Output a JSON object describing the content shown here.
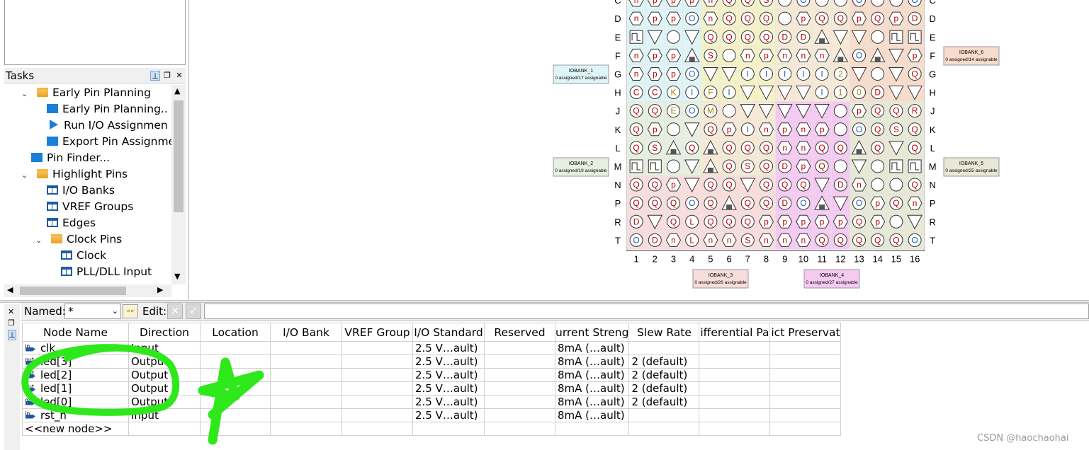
{
  "tasks": {
    "title": "Tasks",
    "tree": [
      {
        "label": "Early Pin Planning",
        "icon": "folder-icon",
        "expanded": true
      },
      {
        "label": "Early Pin Planning..",
        "icon": "task-icon"
      },
      {
        "label": "Run I/O Assignmen",
        "icon": "play-icon"
      },
      {
        "label": "Export Pin Assignme",
        "icon": "task-icon"
      },
      {
        "label": "Pin Finder...",
        "icon": "task-icon"
      },
      {
        "label": "Highlight Pins",
        "icon": "folder-icon",
        "expanded": true
      },
      {
        "label": "I/O Banks",
        "icon": "table-icon"
      },
      {
        "label": "VREF Groups",
        "icon": "table-icon"
      },
      {
        "label": "Edges",
        "icon": "table-icon"
      },
      {
        "label": "Clock Pins",
        "icon": "folder-icon",
        "expanded": true
      },
      {
        "label": "Clock",
        "icon": "table-icon"
      },
      {
        "label": "PLL/DLL Input",
        "icon": "table-icon"
      }
    ]
  },
  "package": {
    "row_labels": [
      "C",
      "D",
      "E",
      "F",
      "G",
      "H",
      "J",
      "K",
      "L",
      "M",
      "N",
      "P",
      "R",
      "T"
    ],
    "col_labels": [
      "1",
      "2",
      "3",
      "4",
      "5",
      "6",
      "7",
      "8",
      "9",
      "10",
      "11",
      "12",
      "13",
      "14",
      "15",
      "16"
    ],
    "iobanks": [
      {
        "name": "IOBANK_1",
        "status": "0 assigned/17 assignable",
        "color": "#dff4f7"
      },
      {
        "name": "IOBANK_2",
        "status": "0 assigned/19 assignable",
        "color": "#e6efe0"
      },
      {
        "name": "IOBANK_3",
        "status": "0 assigned/26 assignable",
        "color": "#f9dcdc"
      },
      {
        "name": "IOBANK_4",
        "status": "0 assigned/27 assignable",
        "color": "#f5c9f2"
      },
      {
        "name": "IOBANK_5",
        "status": "0 assigned/25 assignable",
        "color": "#e7e8d6"
      },
      {
        "name": "IOBANK_6",
        "status": "0 assigned/14 assignable",
        "color": "#f7dccb"
      }
    ],
    "pin_rows": [
      "npppnQQS",
      "nppOnQQQOpQQpQpD",
      "UVOVQQQQDDAVVOUU",
      "nppASOnpnnnAOAVpn",
      "nppOVVIIIII2VOVQp",
      "CCKIFIVVVVI10DVV",
      "QQEOMOVVVVVOpQQRE",
      "QpOVQpInpnpOOQSQ",
      "QSAQAQQQnnQQAQVQ",
      "UUOVAQSQDpQOVOUU",
      "QQpVQQVQQQVDnOOQ",
      "QQQOQAQQDOAVOpQn",
      "DVQLQQQpppppQpOVQ",
      "ODnLnnSnnnQQQQQO"
    ]
  },
  "editor": {
    "named_label": "Named:",
    "named_value": "*",
    "edit_label": "Edit:",
    "columns": [
      "Node Name",
      "Direction",
      "Location",
      "I/O Bank",
      "VREF Group",
      "I/O Standard",
      "Reserved",
      "urrent Streng",
      "Slew Rate",
      "ifferential Pa",
      "ict Preservat"
    ],
    "rows": [
      {
        "dir_tag": "in",
        "node": "clk",
        "direction": "Input",
        "io_standard": "2.5 V…ault)",
        "current": "8mA (…ault)",
        "slew": ""
      },
      {
        "dir_tag": "out",
        "node": "led[3]",
        "direction": "Output",
        "io_standard": "2.5 V…ault)",
        "current": "8mA (…ault)",
        "slew": "2 (default)"
      },
      {
        "dir_tag": "out",
        "node": "led[2]",
        "direction": "Output",
        "io_standard": "2.5 V…ault)",
        "current": "8mA (…ault)",
        "slew": "2 (default)"
      },
      {
        "dir_tag": "out",
        "node": "led[1]",
        "direction": "Output",
        "io_standard": "2.5 V…ault)",
        "current": "8mA (…ault)",
        "slew": "2 (default)"
      },
      {
        "dir_tag": "out",
        "node": "led[0]",
        "direction": "Output",
        "io_standard": "2.5 V…ault)",
        "current": "8mA (…ault)",
        "slew": "2 (default)"
      },
      {
        "dir_tag": "in",
        "node": "rst_n",
        "direction": "Input",
        "io_standard": "2.5 V…ault)",
        "current": "8mA (…ault)",
        "slew": ""
      }
    ],
    "new_node": "<<new node>>"
  },
  "watermark": "CSDN @haochaohai",
  "colors": {
    "annotation": "#2ee81c",
    "pin_text": "#c00000",
    "accent_blue": "#1a7fd8"
  }
}
